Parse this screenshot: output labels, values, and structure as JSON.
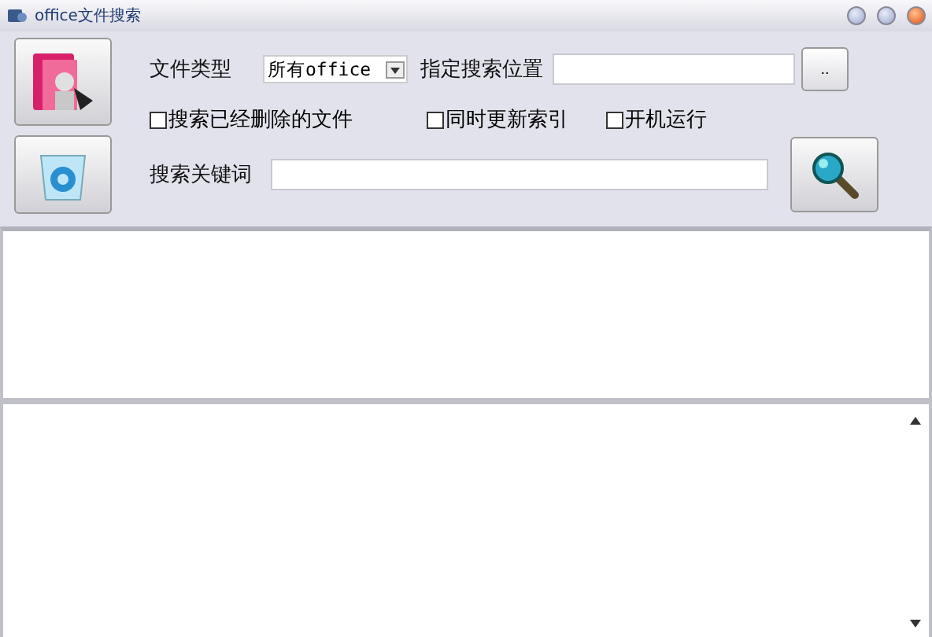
{
  "window": {
    "title": "office文件搜索"
  },
  "file_type": {
    "label": "文件类型",
    "value": "所有office"
  },
  "location": {
    "label": "指定搜索位置",
    "browse": ".."
  },
  "options": [
    {
      "label": "搜索已经删除的文件",
      "checked": false
    },
    {
      "label": "同时更新索引",
      "checked": false
    },
    {
      "label": "开机运行",
      "checked": false
    }
  ],
  "keyword": {
    "label": "搜索关键词"
  }
}
